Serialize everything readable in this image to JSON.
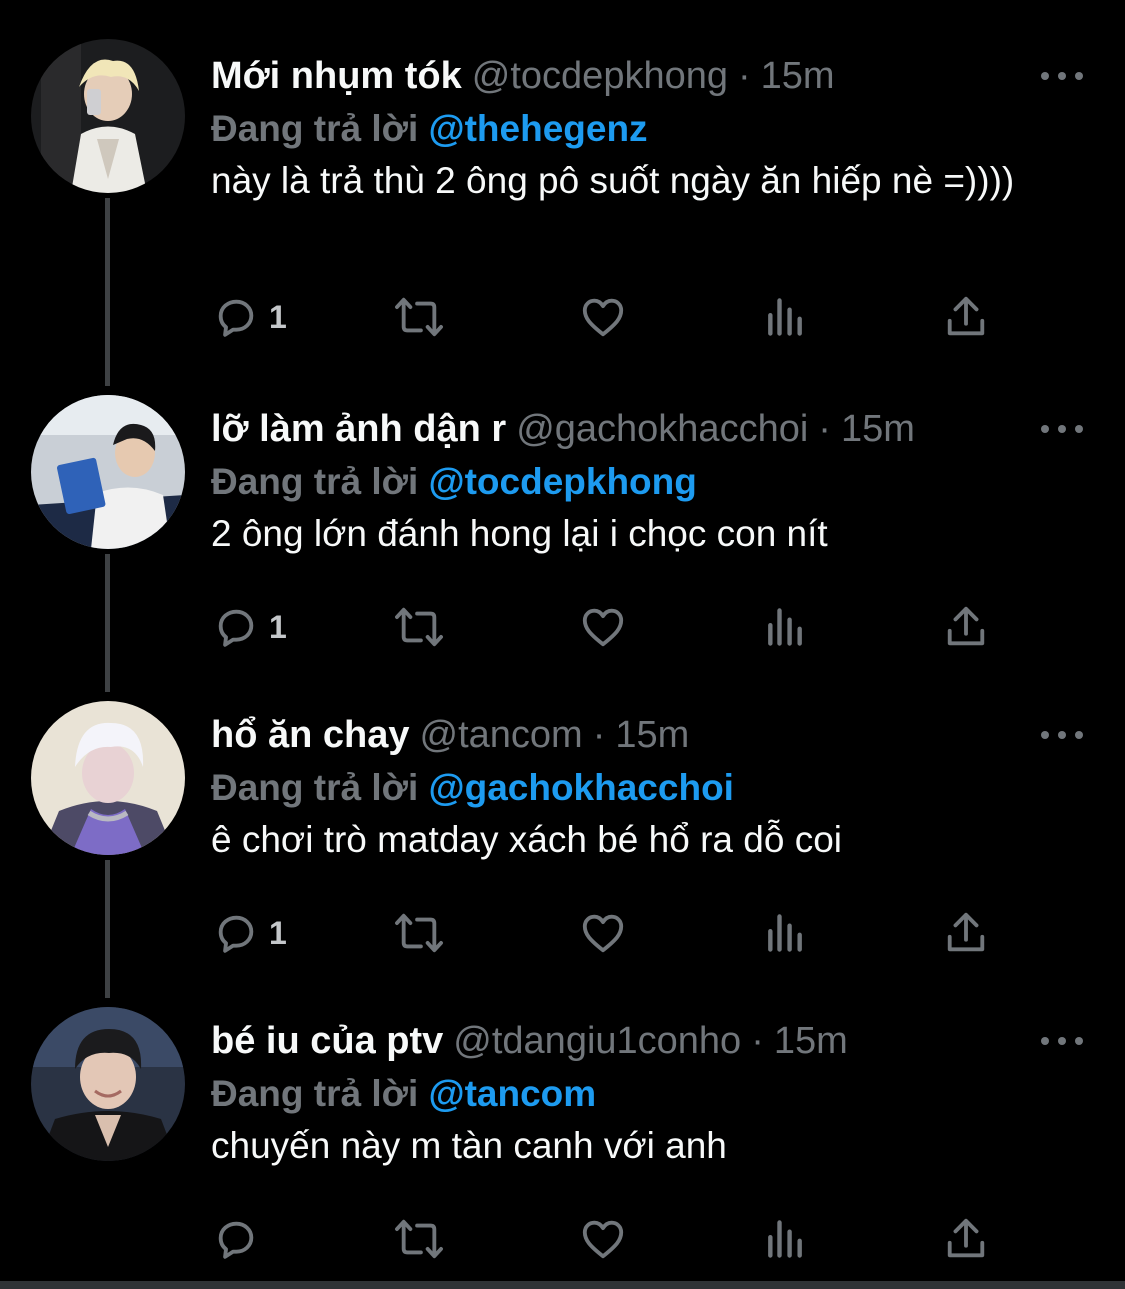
{
  "colors": {
    "background": "#000000",
    "text": "#f7f9f9",
    "muted": "#71767b",
    "mention": "#1d9bf0",
    "thread_line": "#3e4144"
  },
  "tweets": [
    {
      "name": "Mới nhụm tók",
      "handle": "@tocdepkhong",
      "sep": "·",
      "time": "15m",
      "reply_label": "Đang trả lời",
      "reply_to": "@thehegenz",
      "text": "này là trả thù 2 ông pô suốt ngày ăn hiếp nè =))))",
      "reply_count": "1"
    },
    {
      "name": "lỡ làm ảnh dận r",
      "handle": "@gachokhacchoi",
      "sep": "·",
      "time": "15m",
      "reply_label": "Đang trả lời",
      "reply_to": "@tocdepkhong",
      "text": "2 ông lớn đánh hong lại i chọc con nít",
      "reply_count": "1"
    },
    {
      "name": "hổ ăn chay",
      "handle": "@tancom",
      "sep": "·",
      "time": "15m",
      "reply_label": "Đang trả lời",
      "reply_to": "@gachokhacchoi",
      "text": "ê chơi trò matday xách bé hổ ra dỗ coi",
      "reply_count": "1"
    },
    {
      "name": "bé iu của ptv",
      "handle": "@tdangiu1conho",
      "sep": "·",
      "time": "15m",
      "reply_label": "Đang trả lời",
      "reply_to": "@tancom",
      "text": "chuyến này m tàn canh với anh",
      "reply_count": ""
    }
  ],
  "icons": {
    "more": "more-icon",
    "reply": "reply-icon",
    "retweet": "retweet-icon",
    "like": "like-icon",
    "views": "views-icon",
    "share": "share-icon"
  }
}
